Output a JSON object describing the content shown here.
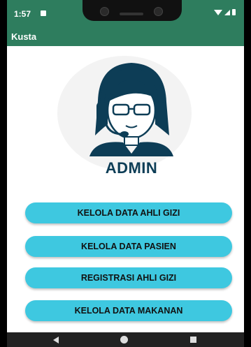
{
  "status_bar": {
    "time": "1:57"
  },
  "app_bar": {
    "title": "Kusta"
  },
  "avatar": {
    "label": "ADMIN"
  },
  "menu": {
    "buttons": [
      {
        "label": "KELOLA DATA AHLI GIZI"
      },
      {
        "label": "KELOLA DATA PASIEN"
      },
      {
        "label": "REGISTRASI AHLI GIZI"
      },
      {
        "label": "KELOLA DATA MAKANAN"
      }
    ]
  },
  "colors": {
    "app_bar": "#2e7d5e",
    "button": "#3ec8e0",
    "admin_text": "#0d3d56"
  },
  "icons": [
    "notification-icon",
    "wifi-icon",
    "signal-icon",
    "battery-icon",
    "admin-avatar-icon",
    "back-icon",
    "home-icon",
    "recents-icon"
  ]
}
